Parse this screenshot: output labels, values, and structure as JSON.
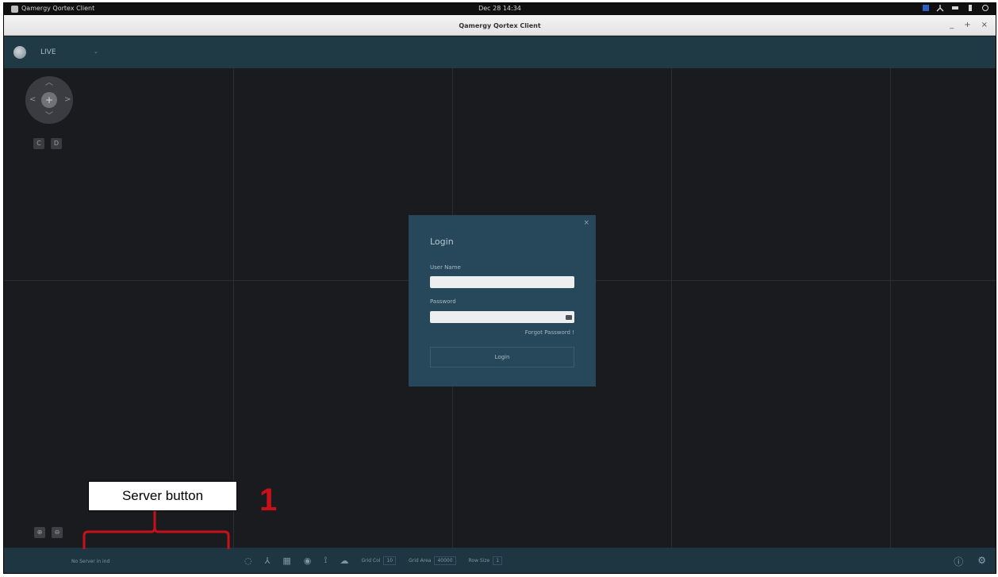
{
  "os_panel": {
    "app_menu": "Qamergy Qortex Client",
    "clock": "Dec 28 14:34"
  },
  "window": {
    "title": "Qamergy Qortex Client",
    "controls": [
      "_",
      "+",
      "×"
    ]
  },
  "app_header": {
    "mode": "LIVE",
    "mode_caret": "⌄"
  },
  "ptz": {
    "center_icon": "+",
    "left_btn": "C",
    "right_btn": "D"
  },
  "zoom": {
    "zoom_in": "⊕",
    "zoom_out": "⊖"
  },
  "login": {
    "close": "×",
    "title": "Login",
    "username_label": "User Name",
    "password_label": "Password",
    "forgot": "Forgot Password !",
    "button": "Login",
    "username_value": "",
    "password_value": ""
  },
  "bottombar": {
    "server_info": "No Server in ind",
    "fields": [
      {
        "label": "Grid Col",
        "value": "10"
      },
      {
        "label": "Grid Area",
        "value": "40000"
      },
      {
        "label": "Row Size",
        "value": "1"
      }
    ]
  },
  "annotation": {
    "label": "Server button",
    "number": "1",
    "color": "#c8101a"
  }
}
